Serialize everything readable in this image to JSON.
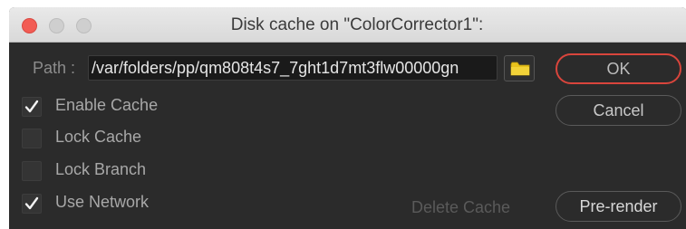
{
  "window": {
    "title": "Disk cache on \"ColorCorrector1\":"
  },
  "path": {
    "label": "Path :",
    "value": "/var/folders/pp/qm808t4s7_7ght1d7mt3flw00000gn"
  },
  "options": [
    {
      "label": "Enable Cache",
      "checked": true
    },
    {
      "label": "Lock Cache",
      "checked": false
    },
    {
      "label": "Lock Branch",
      "checked": false
    },
    {
      "label": "Use Network",
      "checked": true
    }
  ],
  "buttons": {
    "ok": "OK",
    "cancel": "Cancel",
    "delete_cache": "Delete Cache",
    "prerender": "Pre-render"
  },
  "colors": {
    "accent_red": "#d9453c",
    "folder_yellow": "#e8c21c"
  },
  "icons": {
    "browse": "folder-icon",
    "check": "checkmark-icon"
  }
}
